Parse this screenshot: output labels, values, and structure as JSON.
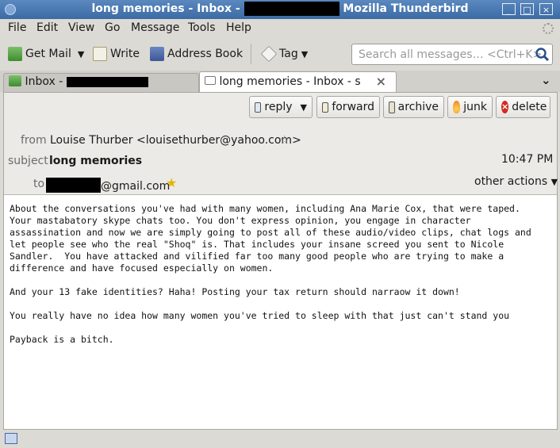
{
  "window": {
    "title_prefix": "long memories - Inbox - ",
    "title_suffix": " Mozilla Thunderbird",
    "buttons": [
      "_",
      "□",
      "×"
    ]
  },
  "menubar": [
    "File",
    "Edit",
    "View",
    "Go",
    "Message",
    "Tools",
    "Help"
  ],
  "toolbar": {
    "get_mail": "Get Mail",
    "write": "Write",
    "address_book": "Address Book",
    "tag": "Tag",
    "search_placeholder": "Search all messages… <Ctrl+K>"
  },
  "tabs": {
    "inbox_label": "Inbox - ",
    "message_label": "long memories - Inbox - s",
    "close": "×",
    "overflow": "⌄"
  },
  "actions": {
    "reply": "reply",
    "forward": "forward",
    "archive": "archive",
    "junk": "junk",
    "delete": "delete"
  },
  "header": {
    "from_label": "from",
    "from_value": "Louise Thurber <louisethurber@yahoo.com>",
    "subject_label": "subject",
    "subject_value": "long memories",
    "time": "10:47 PM",
    "to_label": "to",
    "to_domain": "@gmail.com",
    "other_actions": "other actions"
  },
  "body": "About the conversations you've had with many women, including Ana Marie Cox, that were taped.\nYour mastabatory skype chats too. You don't express opinion, you engage in character\nassassination and now we are simply going to post all of these audio/video clips, chat logs and\nlet people see who the real \"Shoq\" is. That includes your insane screed you sent to Nicole\nSandler.  You have attacked and vilified far too many good people who are trying to make a\ndifference and have focused especially on women.\n\nAnd your 13 fake identities? Haha! Posting your tax return should narraow it down!\n\nYou really have no idea how many women you've tried to sleep with that just can't stand you\n\nPayback is a bitch."
}
